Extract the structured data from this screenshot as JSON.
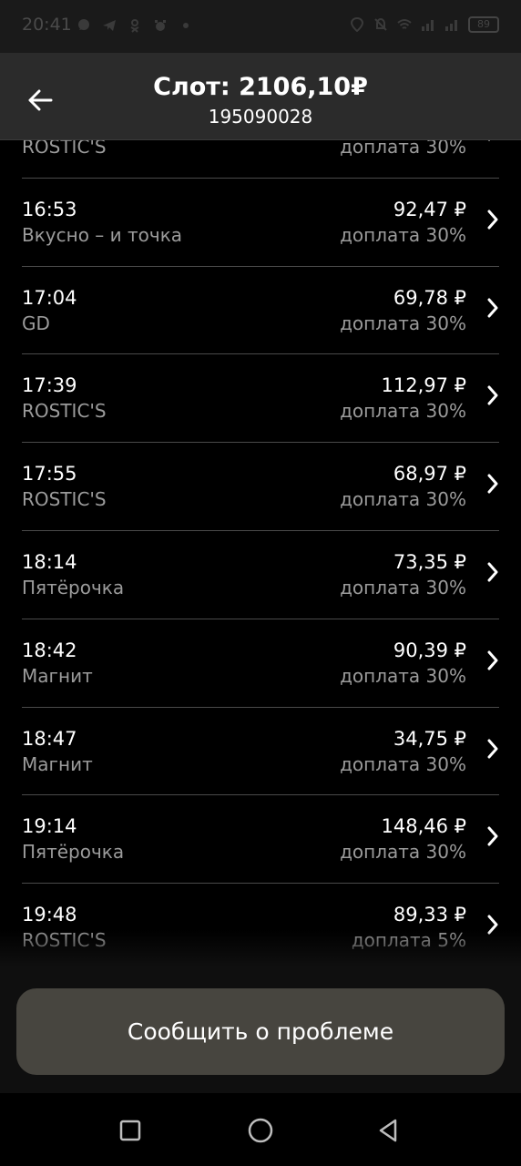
{
  "status_bar": {
    "time": "20:41",
    "battery": "89"
  },
  "header": {
    "title": "Слот: 2106,10₽",
    "subtitle": "195090028"
  },
  "orders": [
    {
      "time": "",
      "place": "ROSTIC'S",
      "amount": "",
      "extra": "доплата 30%"
    },
    {
      "time": "16:53",
      "place": "Вкусно – и точка",
      "amount": "92,47 ₽",
      "extra": "доплата 30%"
    },
    {
      "time": "17:04",
      "place": "GD",
      "amount": "69,78 ₽",
      "extra": "доплата 30%"
    },
    {
      "time": "17:39",
      "place": "ROSTIC'S",
      "amount": "112,97 ₽",
      "extra": "доплата 30%"
    },
    {
      "time": "17:55",
      "place": "ROSTIC'S",
      "amount": "68,97 ₽",
      "extra": "доплата 30%"
    },
    {
      "time": "18:14",
      "place": "Пятёрочка",
      "amount": "73,35 ₽",
      "extra": "доплата 30%"
    },
    {
      "time": "18:42",
      "place": "Магнит",
      "amount": "90,39 ₽",
      "extra": "доплата 30%"
    },
    {
      "time": "18:47",
      "place": "Магнит",
      "amount": "34,75 ₽",
      "extra": "доплата 30%"
    },
    {
      "time": "19:14",
      "place": "Пятёрочка",
      "amount": "148,46 ₽",
      "extra": "доплата 30%"
    },
    {
      "time": "19:48",
      "place": "ROSTIC'S",
      "amount": "89,33 ₽",
      "extra": "доплата 5%"
    }
  ],
  "actions": {
    "report_label": "Сообщить о проблеме"
  },
  "icons": {
    "back": "arrow-left-icon",
    "chevron": "chevron-right-icon",
    "nav_recents": "square-icon",
    "nav_home": "circle-icon",
    "nav_back": "triangle-back-icon"
  },
  "colors": {
    "background": "#000000",
    "header": "#2b2b2b",
    "secondary_text": "#9b9b9b",
    "button": "#47453f"
  }
}
